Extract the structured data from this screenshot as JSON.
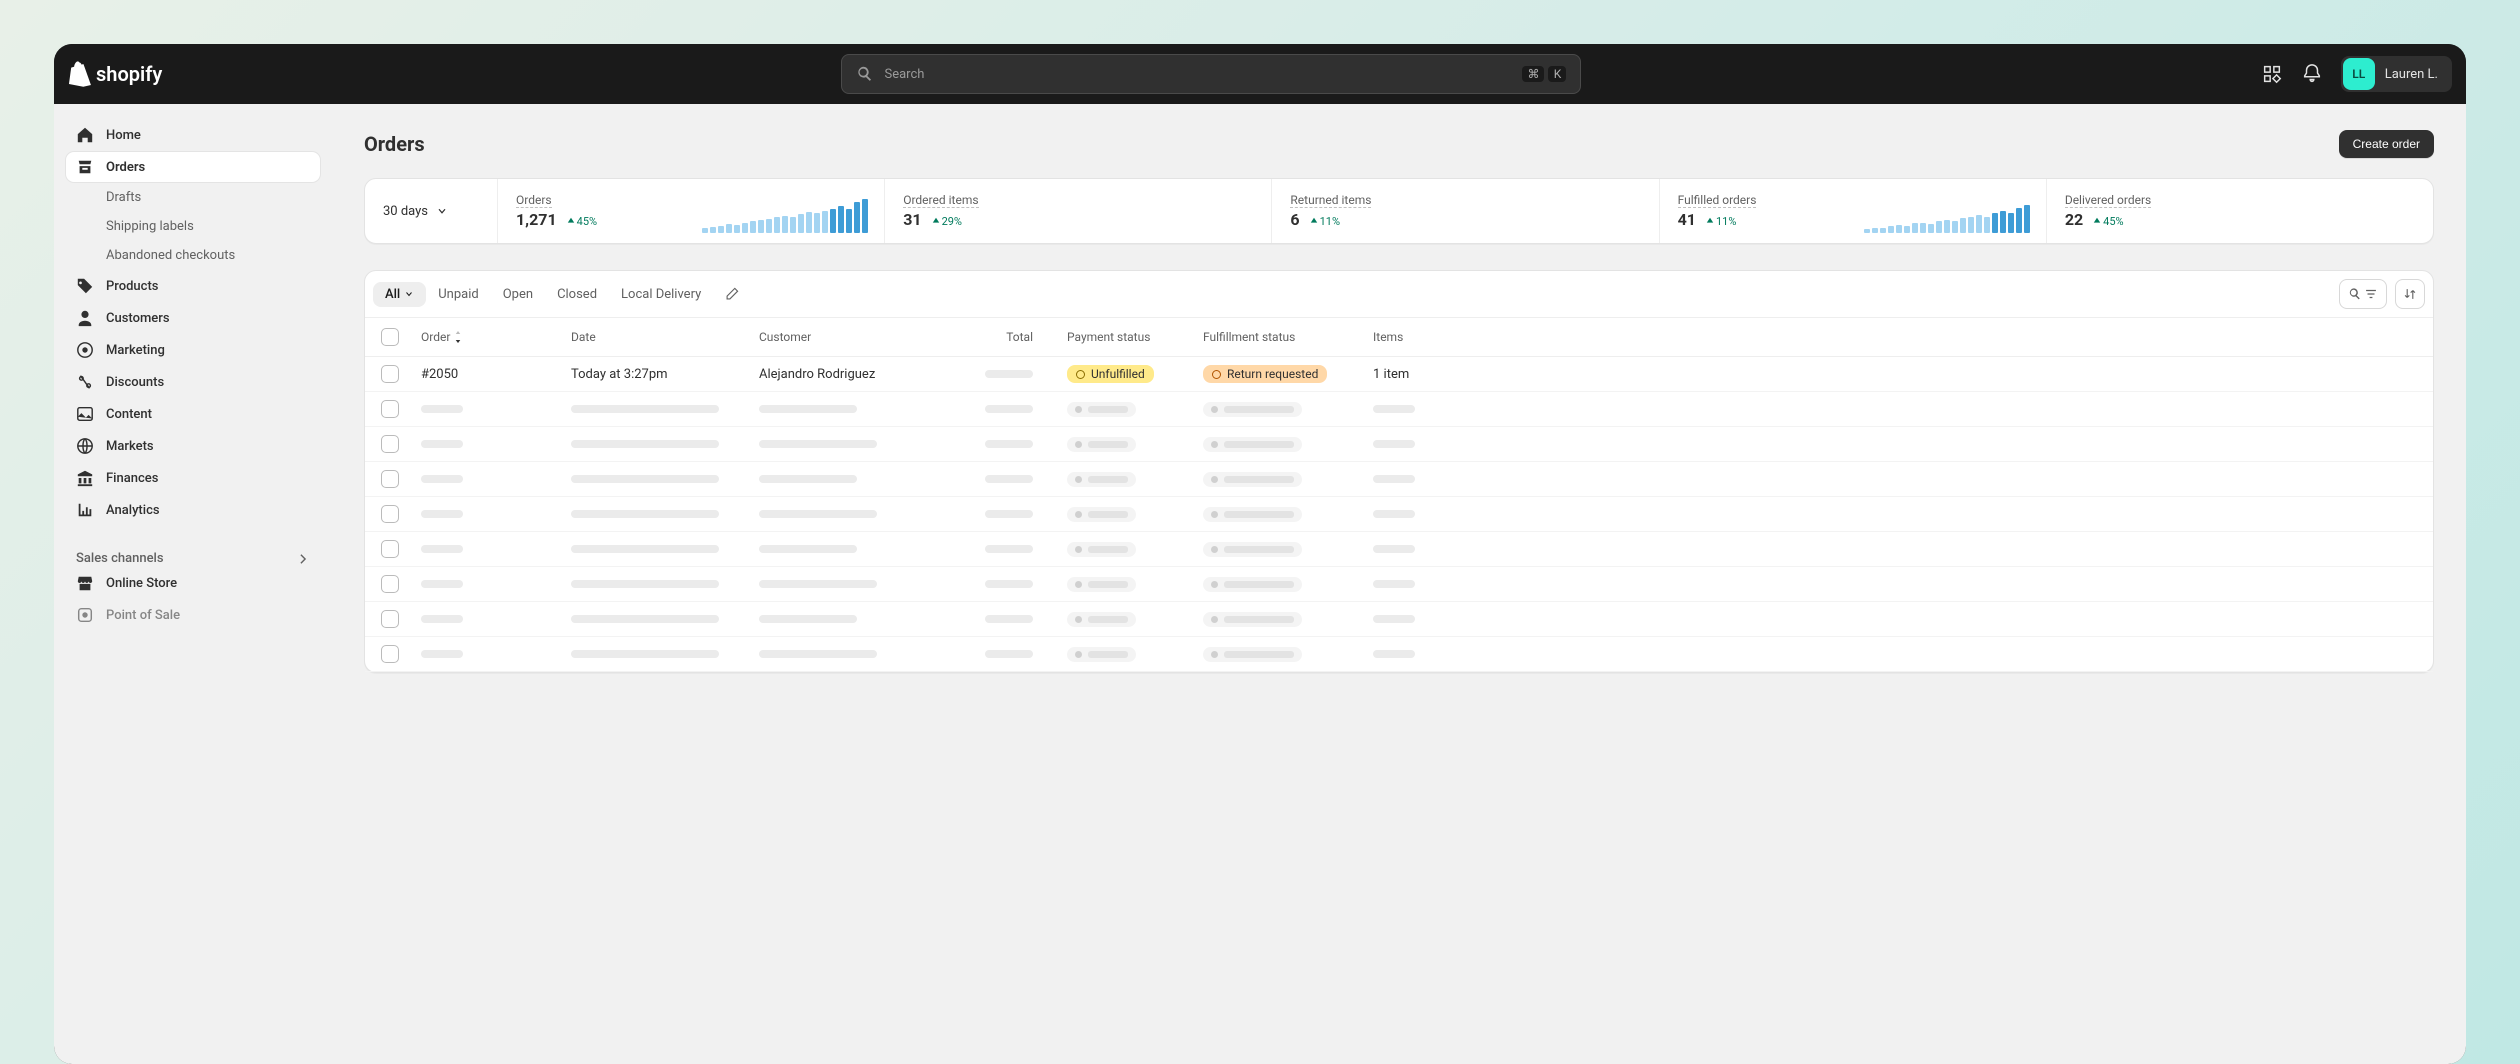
{
  "brand": "shopify",
  "search": {
    "placeholder": "Search",
    "kbd1": "⌘",
    "kbd2": "K"
  },
  "user": {
    "initials": "LL",
    "name": "Lauren L."
  },
  "sidebar": {
    "home": "Home",
    "orders": "Orders",
    "drafts": "Drafts",
    "shipping": "Shipping labels",
    "abandoned": "Abandoned checkouts",
    "products": "Products",
    "customers": "Customers",
    "marketing": "Marketing",
    "discounts": "Discounts",
    "content": "Content",
    "markets": "Markets",
    "finances": "Finances",
    "analytics": "Analytics",
    "sales_channels": "Sales channels",
    "online_store": "Online Store",
    "pos": "Point of Sale"
  },
  "page": {
    "title": "Orders",
    "create_btn": "Create order",
    "range": "30 days"
  },
  "stats": [
    {
      "label": "Orders",
      "value": "1,271",
      "delta": "45%",
      "spark": true
    },
    {
      "label": "Ordered items",
      "value": "31",
      "delta": "29%",
      "spark": false
    },
    {
      "label": "Returned items",
      "value": "6",
      "delta": "11%",
      "spark": false
    },
    {
      "label": "Fulfilled orders",
      "value": "41",
      "delta": "11%",
      "spark": true
    },
    {
      "label": "Delivered orders",
      "value": "22",
      "delta": "45%",
      "spark": false
    }
  ],
  "tabs": {
    "all": "All",
    "unpaid": "Unpaid",
    "open": "Open",
    "closed": "Closed",
    "local": "Local Delivery"
  },
  "columns": {
    "order": "Order",
    "date": "Date",
    "total": "Total",
    "customer": "Customer",
    "payment": "Payment status",
    "fulfillment": "Fulfillment status",
    "items": "Items"
  },
  "row": {
    "order": "#2050",
    "date": "Today at 3:27pm",
    "customer": "Alejandro Rodriguez",
    "payment": "Unfulfilled",
    "fulfillment": "Return requested",
    "items": "1 item"
  }
}
